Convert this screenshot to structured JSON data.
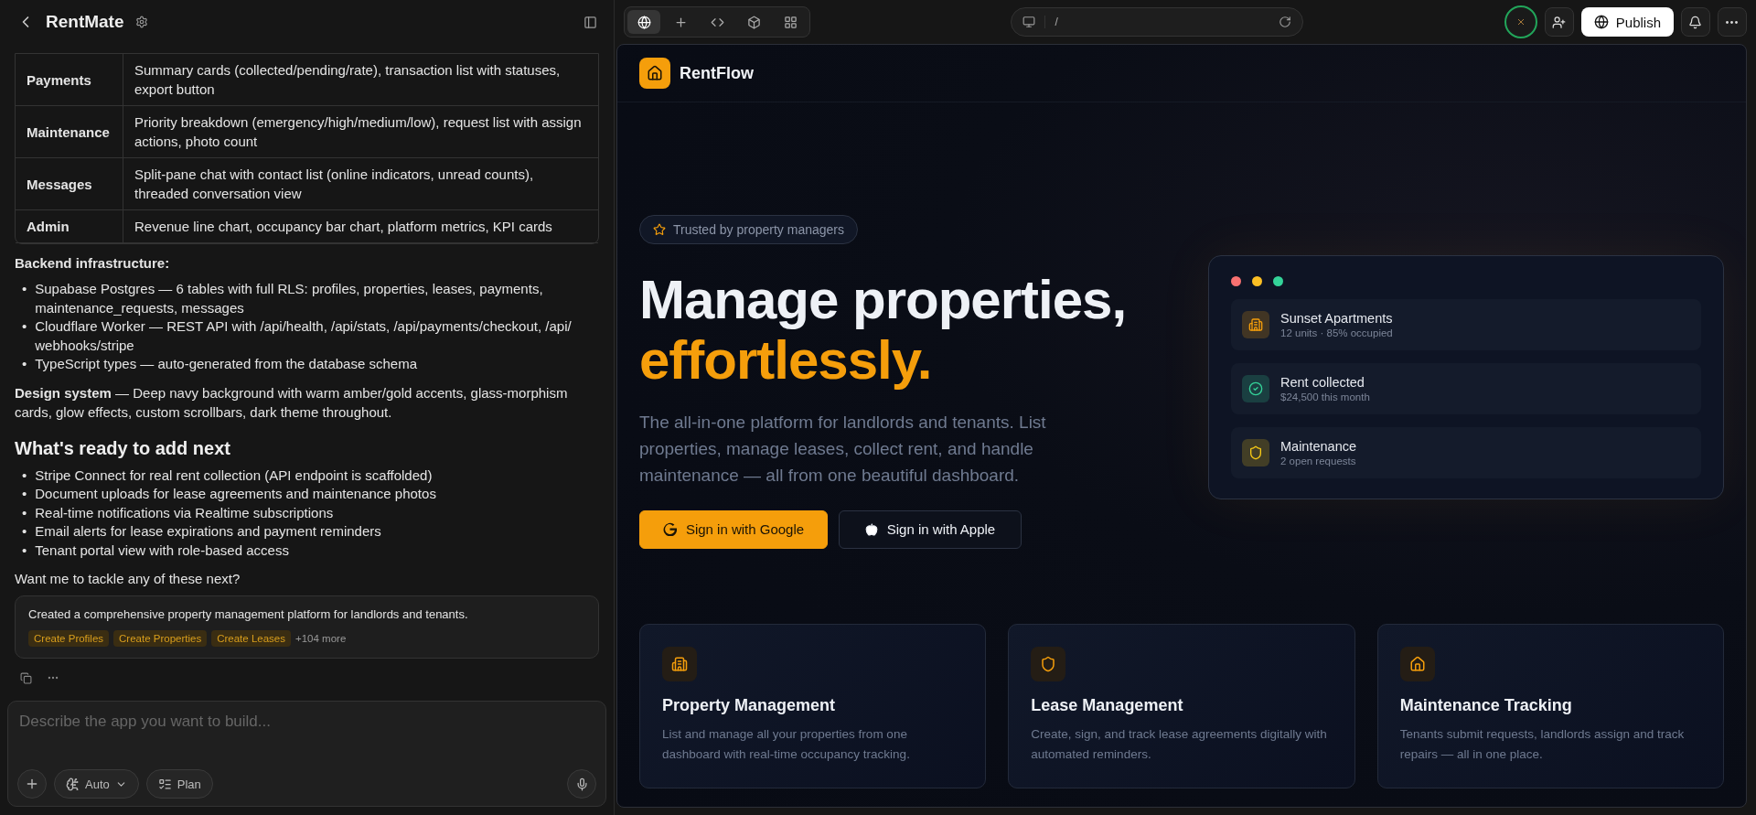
{
  "app": {
    "title": "RentMate"
  },
  "table": {
    "rows": [
      {
        "feature": "Payments",
        "description": "Summary cards (collected/pending/rate), transaction list with statuses, export button"
      },
      {
        "feature": "Maintenance",
        "description": "Priority breakdown (emergency/high/medium/low), request list with assign actions, photo count"
      },
      {
        "feature": "Messages",
        "description": "Split-pane chat with contact list (online indicators, unread counts), threaded conversation view"
      },
      {
        "feature": "Admin",
        "description": "Revenue line chart, occupancy bar chart, platform metrics, KPI cards"
      }
    ]
  },
  "backend": {
    "heading": "Backend infrastructure:",
    "bullet": "•",
    "items": [
      "Supabase Postgres — 6 tables with full RLS: profiles, properties, leases, payments, maintenance_requests, messages",
      "Cloudflare Worker — REST API with /api/health, /api/stats, /api/payments/checkout, /api/ webhooks/stripe",
      "TypeScript types — auto-generated from the database schema"
    ]
  },
  "design_system": "**Design system** — Deep navy background with warm amber/gold accents, glass-morphism cards, glow effects, custom scrollbars, dark theme throughout.",
  "next": {
    "heading": "What's ready to add next",
    "bullet": "•",
    "items": [
      "Stripe Connect for real rent collection (API endpoint is scaffolded)",
      "Document uploads for lease agreements and maintenance photos",
      "Real-time notifications via Realtime subscriptions",
      "Email alerts for lease expirations and payment reminders",
      "Tenant portal view with role-based access"
    ]
  },
  "question": "Want me to tackle any of these next?",
  "summary_card": {
    "text": "Created a comprehensive property management platform for landlords and tenants.",
    "tags": [
      "Create Profiles",
      "Create Properties",
      "Create Leases"
    ],
    "more": "+104 more"
  },
  "composer": {
    "placeholder": "Describe the app you want to build...",
    "mode": "Auto",
    "plan": "Plan"
  },
  "toolbar": {
    "tabs": [
      {
        "kind": "globe",
        "selected": true
      },
      {
        "kind": "plus",
        "selected": false
      },
      {
        "kind": "code",
        "selected": false
      },
      {
        "kind": "cube",
        "selected": false
      },
      {
        "kind": "grid",
        "selected": false
      }
    ],
    "path": "/",
    "publish": "Publish"
  },
  "preview": {
    "brand": "RentFlow",
    "badge": "Trusted by property managers",
    "headline": "Manage properties,",
    "headline_accent": "effortlessly.",
    "lead": "The all-in-one platform for landlords and tenants. List properties, manage leases, collect rent, and handle maintenance — all from one beautiful dashboard.",
    "buttons": [
      {
        "kind": "primary",
        "label": "Sign in with Google"
      },
      {
        "kind": "secondary",
        "label": "Sign in with Apple"
      }
    ],
    "mock": {
      "dots": [
        {
          "color": "#f87171"
        },
        {
          "color": "#fbbf24"
        },
        {
          "color": "#34d399"
        }
      ],
      "rows": [
        {
          "kind": "building",
          "title": "Sunset Apartments",
          "subtitle": "12 units · 85% occupied",
          "color": "#f59e0b"
        },
        {
          "kind": "check",
          "title": "Rent collected",
          "subtitle": "$24,500 this month",
          "color": "#34d399"
        },
        {
          "kind": "shield",
          "title": "Maintenance",
          "subtitle": "2 open requests",
          "color": "#facc15"
        }
      ]
    },
    "features": [
      {
        "kind": "building",
        "title": "Property Management",
        "text": "List and manage all your properties from one dashboard with real-time occupancy tracking."
      },
      {
        "kind": "shield",
        "title": "Lease Management",
        "text": "Create, sign, and track lease agreements digitally with automated reminders."
      },
      {
        "kind": "home",
        "title": "Maintenance Tracking",
        "text": "Tenants submit requests, landlords assign and track repairs — all in one place."
      }
    ]
  }
}
